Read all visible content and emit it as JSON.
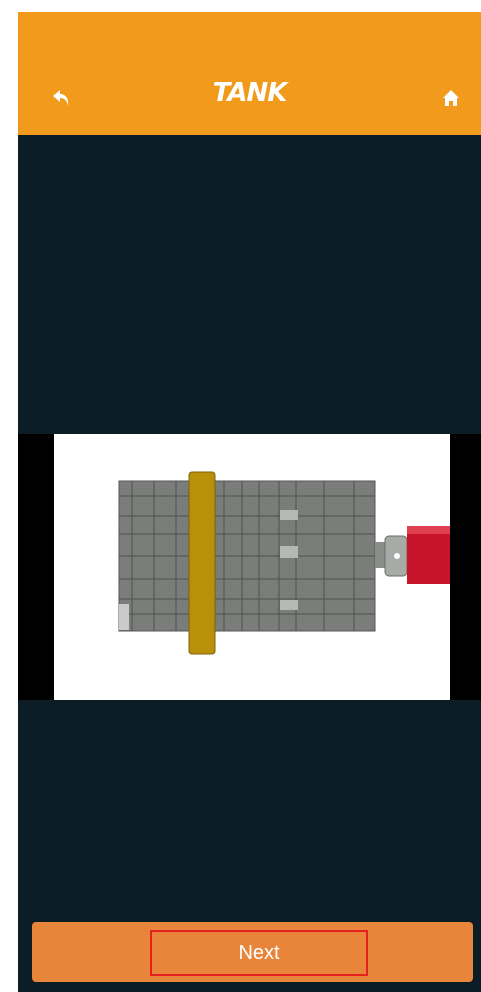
{
  "header": {
    "title": "TANK",
    "back_icon": "back-arrow-icon",
    "home_icon": "home-icon",
    "background_color": "#f19a1b"
  },
  "viewer": {
    "background_color": "#0d1d28",
    "model_colors": {
      "frame": "#7a7d7a",
      "beam": "#b8900a",
      "axle": "#c8142a"
    }
  },
  "footer": {
    "next_label": "Next",
    "background_color": "#e8853a",
    "highlight_color": "#e52020"
  }
}
